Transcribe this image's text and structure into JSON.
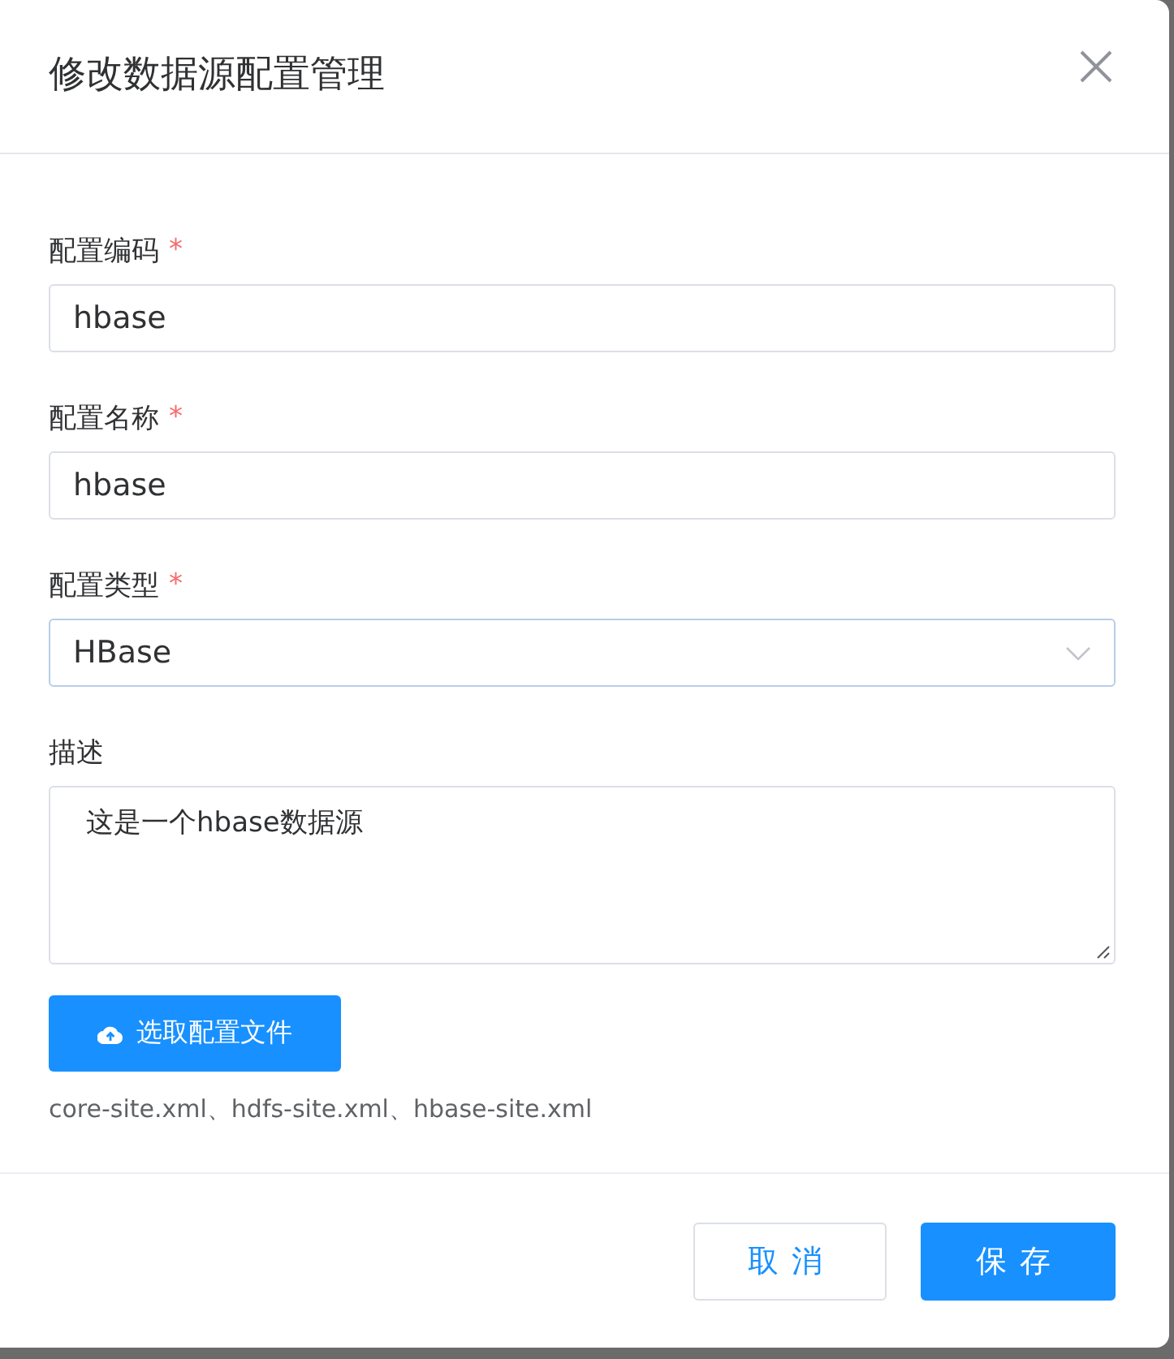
{
  "dialog": {
    "title": "修改数据源配置管理"
  },
  "fields": [
    {
      "kind": "input",
      "label": "配置编码",
      "required": true,
      "value": "hbase"
    },
    {
      "kind": "input",
      "label": "配置名称",
      "required": true,
      "value": "hbase"
    },
    {
      "kind": "select",
      "label": "配置类型",
      "required": true,
      "value": "HBase"
    },
    {
      "kind": "textarea",
      "label": "描述",
      "required": false,
      "value": "这是一个hbase数据源"
    }
  ],
  "required_mark": "*",
  "upload": {
    "button": "选取配置文件",
    "hint": "core-site.xml、hdfs-site.xml、hbase-site.xml"
  },
  "buttons": [
    {
      "kind": "secondary",
      "label": "取消"
    },
    {
      "kind": "primary",
      "label": "保存"
    }
  ]
}
